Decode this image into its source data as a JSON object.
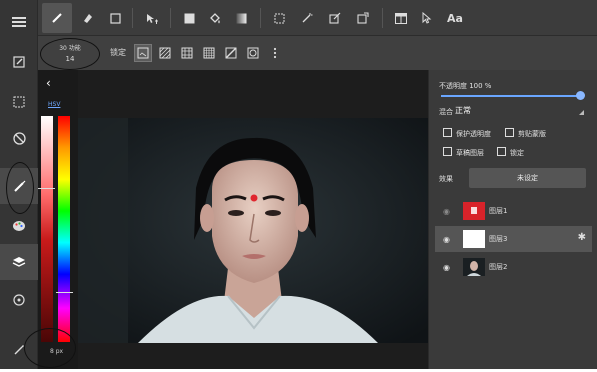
{
  "toolbar": {
    "tools": [
      "brush",
      "eraser",
      "shape",
      "move",
      "fill-rect",
      "bucket",
      "gradient",
      "selection",
      "line",
      "transform",
      "stamp",
      "layout",
      "pointer"
    ],
    "text_tool_label": "Aa"
  },
  "subbar": {
    "brush_size_caption": "30 功能",
    "brush_size_value": "14",
    "lock_label": "锁定"
  },
  "color_panel": {
    "mode_label": "HSV",
    "size_label": "8 px"
  },
  "layers_panel": {
    "opacity_label": "不透明度 100 %",
    "opacity_value": 100,
    "blend_label": "混合",
    "blend_value": "正常",
    "options": {
      "protect_alpha": "保护透明度",
      "clip": "剪贴蒙版",
      "draft": "草稿图层",
      "lock": "锁定"
    },
    "effect_label": "效果",
    "effect_value": "未设定",
    "layers": [
      {
        "name": "图层1",
        "visible": false,
        "thumb": "red"
      },
      {
        "name": "图层3",
        "visible": true,
        "thumb": "white"
      },
      {
        "name": "图层2",
        "visible": true,
        "thumb": "photo"
      }
    ]
  },
  "colors": {
    "accent": "#6aa6ff",
    "panel": "#3a3a3a",
    "canvas": "#1d1d1d"
  }
}
